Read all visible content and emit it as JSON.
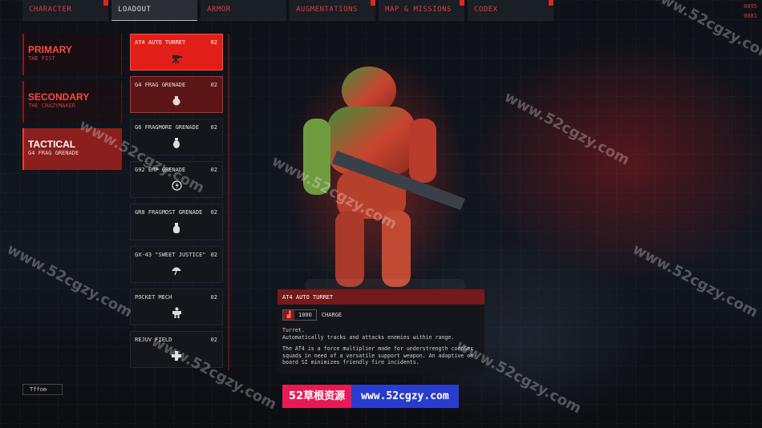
{
  "tabs": [
    {
      "label": "CHARACTER",
      "active": false
    },
    {
      "label": "LOADOUT",
      "active": true
    },
    {
      "label": "ARMOR",
      "active": false
    },
    {
      "label": "AUGMENTATIONS",
      "active": false
    },
    {
      "label": "MAP & MISSIONS",
      "active": false
    },
    {
      "label": "CODEX",
      "active": false
    }
  ],
  "corner_codes": [
    "0095",
    "0081"
  ],
  "slots": [
    {
      "title": "PRIMARY",
      "subtitle": "THE FIST"
    },
    {
      "title": "SECONDARY",
      "subtitle": "THE CRAZYMAKER"
    },
    {
      "title": "TACTICAL",
      "subtitle": "G4 FRAG GRENADE"
    }
  ],
  "items": [
    {
      "name": "AT4 AUTO TURRET",
      "count": "02",
      "icon": "turret-icon"
    },
    {
      "name": "G4 FRAG GRENADE",
      "count": "02",
      "icon": "grenade-icon"
    },
    {
      "name": "G6 FRAGMORE GRENADE",
      "count": "02",
      "icon": "grenade-icon"
    },
    {
      "name": "G92 EMP GRENADE",
      "count": "02",
      "icon": "emp-icon"
    },
    {
      "name": "GR8 FRAGMOST GRENADE",
      "count": "02",
      "icon": "grenade-icon"
    },
    {
      "name": "GX-43 \"SWEET JUSTICE\"",
      "count": "02",
      "icon": "umbrella-icon"
    },
    {
      "name": "POCKET MECH",
      "count": "02",
      "icon": "mech-icon"
    },
    {
      "name": "REJUV FIELD",
      "count": "02",
      "icon": "cross-icon"
    }
  ],
  "details": {
    "title": "AT4 AUTO TURRET",
    "cost": "1000",
    "type": "CHARGE",
    "description": [
      "Turret.",
      "Automatically tracks and attacks enemies within range.",
      "The AT4 is a force multiplier made for understrength corpSec squads in need of a versatile support weapon. An adaptive on-board SI minimizes friendly fire incidents."
    ]
  },
  "bottom_tag": "Tffom",
  "watermark_banner": {
    "left": "52草根资源",
    "right": "www.52cgzy.com"
  },
  "watermark_text": "www.52cgzy.com",
  "colors": {
    "accent": "#e21e18",
    "dark_red": "#741a1a",
    "banner_pink": "#e51c54",
    "banner_blue": "#2a3ccd"
  }
}
